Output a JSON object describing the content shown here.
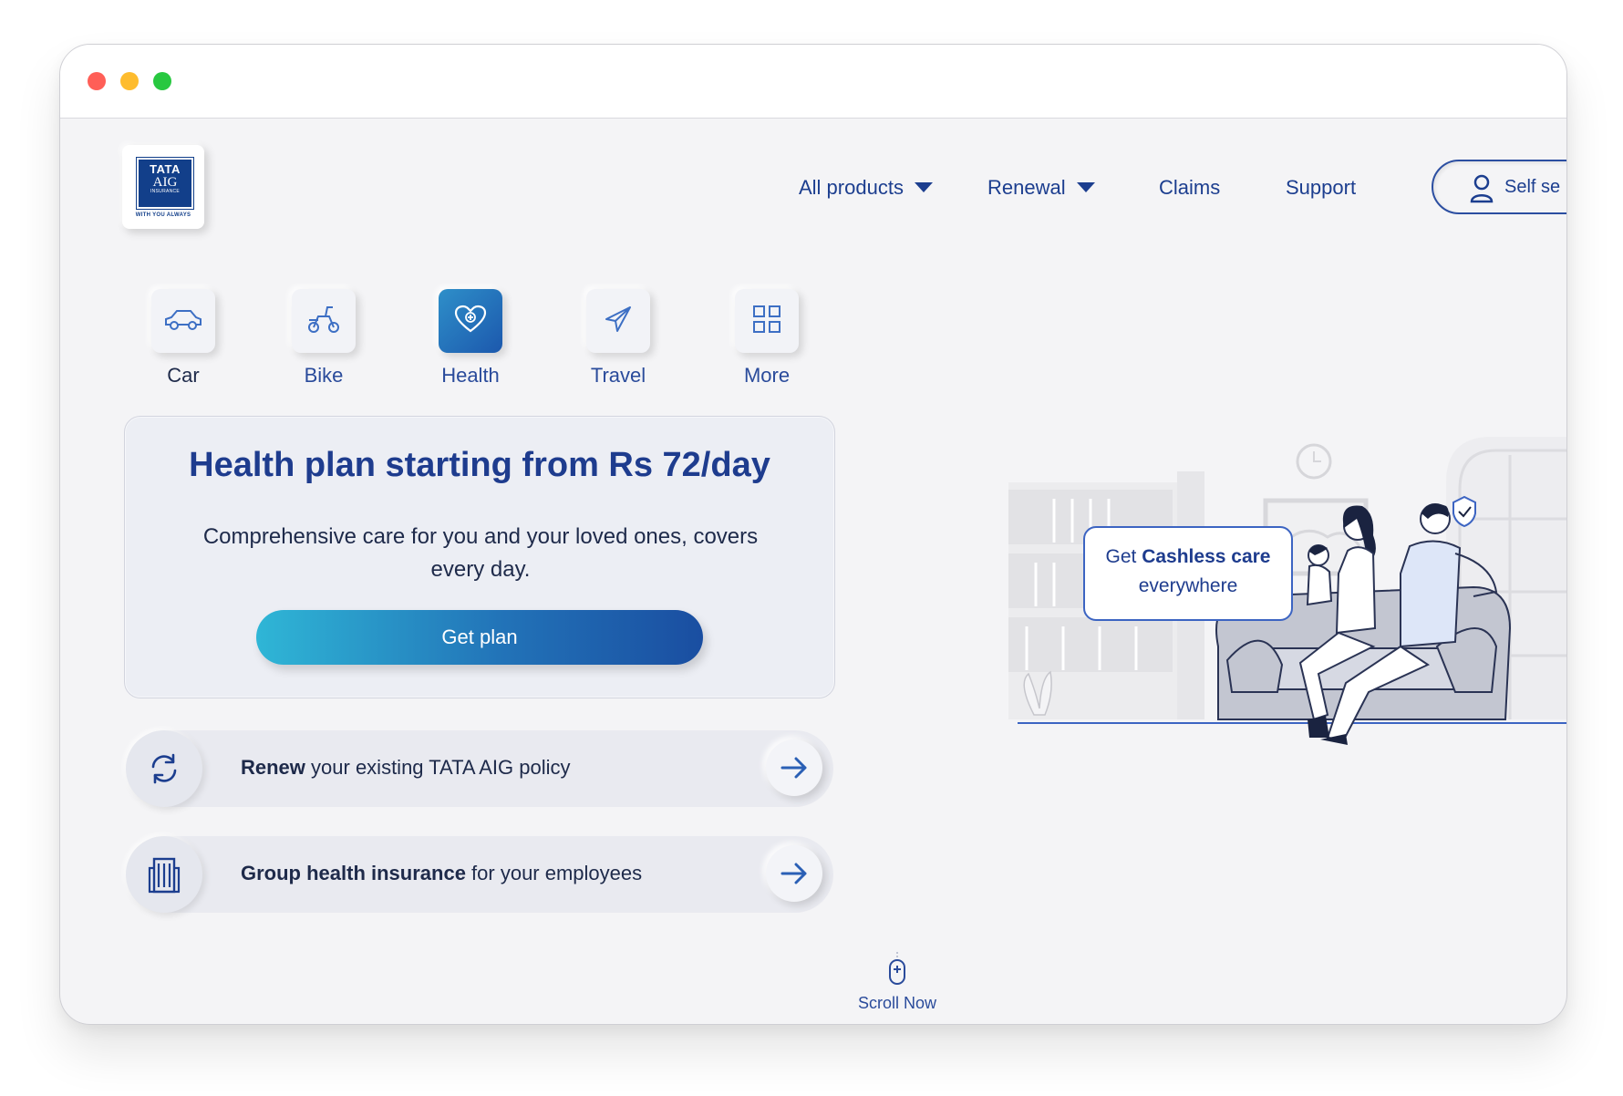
{
  "nav": {
    "all_products": "All products",
    "renewal": "Renewal",
    "claims": "Claims",
    "support": "Support",
    "self_service": "Self se"
  },
  "logo": {
    "line1": "TATA",
    "line2": "AIG",
    "line3": "INSURANCE",
    "tagline": "WITH YOU ALWAYS"
  },
  "categories": [
    {
      "label": "Car",
      "icon": "car-icon"
    },
    {
      "label": "Bike",
      "icon": "bike-icon"
    },
    {
      "label": "Health",
      "icon": "heart-icon",
      "active": true
    },
    {
      "label": "Travel",
      "icon": "plane-icon"
    },
    {
      "label": "More",
      "icon": "grid-icon"
    }
  ],
  "hero": {
    "title": "Health plan starting from Rs 72/day",
    "subtitle": "Comprehensive care for you and your loved ones, covers every day.",
    "cta": "Get plan"
  },
  "links": [
    {
      "bold": "Renew",
      "rest": " your existing TATA AIG policy",
      "icon": "renew-icon"
    },
    {
      "bold": "Group health insurance",
      "rest": " for your employees",
      "icon": "building-icon"
    }
  ],
  "bubble": {
    "prefix": "Get ",
    "bold": "Cashless care",
    "suffix": "everywhere"
  },
  "scroll": {
    "label": "Scroll Now"
  },
  "colors": {
    "brand": "#1c3e8f",
    "accent": "#2fb6d6",
    "logo_bg": "#123f8a"
  }
}
